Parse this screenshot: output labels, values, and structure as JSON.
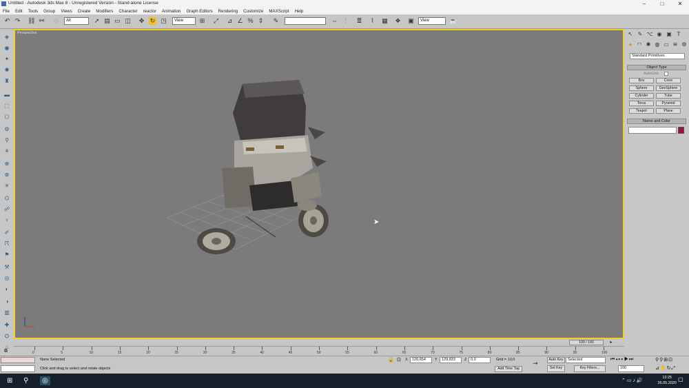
{
  "window": {
    "title": "Untitled - Autodesk 3ds Max 8 - Unregistered Version - Stand-alone License",
    "minimize": "–",
    "maximize": "□",
    "close": "✕"
  },
  "menu": [
    "File",
    "Edit",
    "Tools",
    "Group",
    "Views",
    "Create",
    "Modifiers",
    "Character",
    "reactor",
    "Animation",
    "Graph Editors",
    "Rendering",
    "Customize",
    "MAXScript",
    "Help"
  ],
  "toolbar": {
    "selection_filter": "All",
    "reference_coord": "View",
    "named_selection": "",
    "render_view": "View"
  },
  "viewport": {
    "label": "Perspective"
  },
  "command_panel": {
    "category_dropdown": "Standard Primitives",
    "object_type_header": "Object Type",
    "autogrid_label": "AutoGrid",
    "objects": [
      "Box",
      "Cone",
      "Sphere",
      "GeoSphere",
      "Cylinder",
      "Tube",
      "Torus",
      "Pyramid",
      "Teapot",
      "Plane"
    ],
    "name_color_header": "Name and Color",
    "name_value": "",
    "object_color": "#9a1040"
  },
  "timeline": {
    "slider_label": "100 / 100",
    "ruler_ticks": [
      "0",
      "5",
      "10",
      "15",
      "20",
      "25",
      "30",
      "35",
      "40",
      "45",
      "50",
      "55",
      "60",
      "65",
      "70",
      "75",
      "80",
      "85",
      "90",
      "95",
      "100"
    ]
  },
  "status": {
    "selection_status": "None Selected",
    "prompt": "Click and drag to select and rotate objects",
    "x_label": "X",
    "x_value": "120,654",
    "y_label": "Y",
    "y_value": "129,833",
    "z_label": "Z",
    "z_value": "0,0",
    "grid": "Grid = 10,0",
    "add_time_tag": "Add Time Tag",
    "auto_key": "Auto Key",
    "auto_key_mode": "Selected",
    "set_key": "Set Key",
    "key_filters": "Key Filters...",
    "current_frame": "100"
  },
  "taskbar": {
    "time": "13:25",
    "date": "26.05.2020"
  },
  "colors": {
    "viewport_bg": "#7b7b7b",
    "active_border": "#f0d020",
    "panel_bg": "#c8c8c8"
  }
}
